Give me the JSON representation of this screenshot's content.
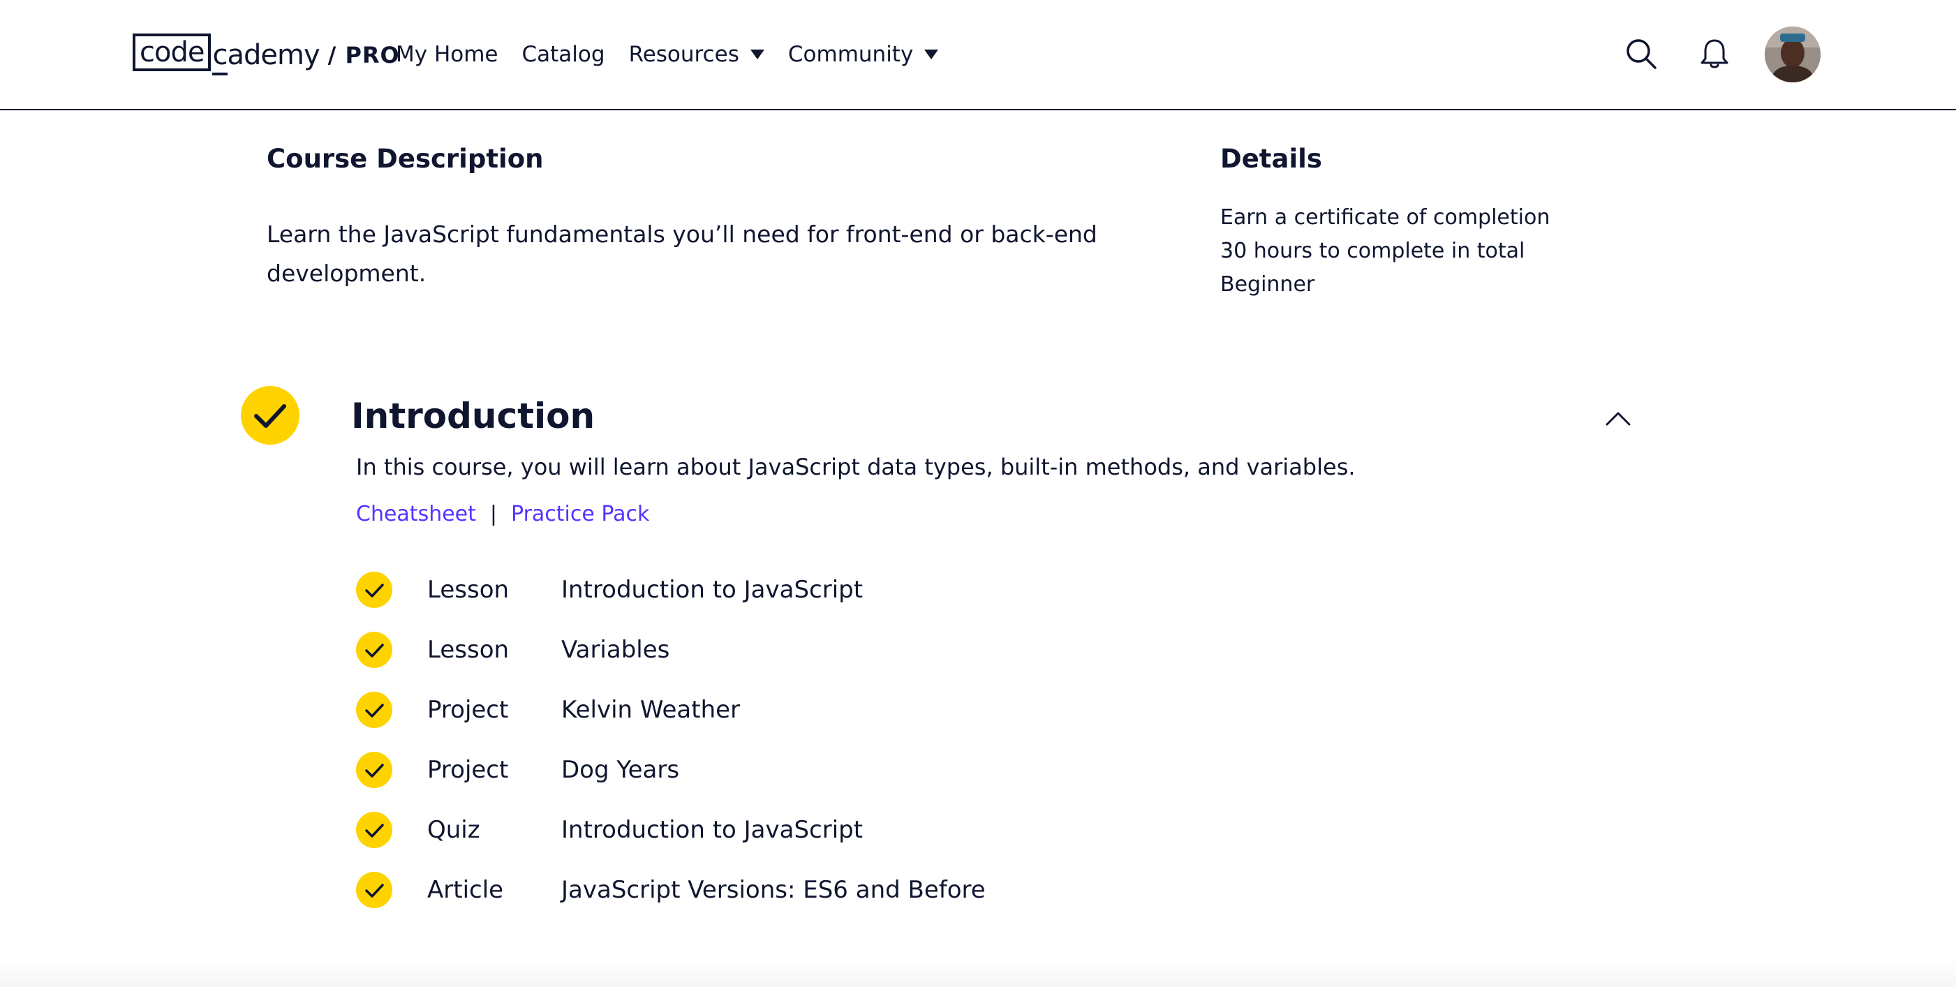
{
  "header": {
    "logo": {
      "code_text": "code",
      "cademy_text": "cademy",
      "pro_text": "/ PRO"
    },
    "nav": [
      {
        "label": "My Home"
      },
      {
        "label": "Catalog"
      },
      {
        "label": "Resources"
      },
      {
        "label": "Community"
      }
    ],
    "icons": {
      "search": "search-icon",
      "notifications": "bell-icon"
    }
  },
  "course": {
    "description_heading": "Course Description",
    "description": "Learn the JavaScript fundamentals you’ll need for front-end or back-end development.",
    "details_heading": "Details",
    "details": [
      "Earn a certificate of completion",
      "30 hours to complete in total",
      "Beginner"
    ]
  },
  "module": {
    "title": "Introduction",
    "description": "In this course, you will learn about JavaScript data types, built-in methods, and variables.",
    "links": {
      "cheatsheet": "Cheatsheet",
      "separator": "|",
      "practice_pack": "Practice Pack"
    },
    "items": [
      {
        "type": "Lesson",
        "title": "Introduction to JavaScript"
      },
      {
        "type": "Lesson",
        "title": "Variables"
      },
      {
        "type": "Project",
        "title": "Kelvin Weather"
      },
      {
        "type": "Project",
        "title": "Dog Years"
      },
      {
        "type": "Quiz",
        "title": "Introduction to JavaScript"
      },
      {
        "type": "Article",
        "title": "JavaScript Versions: ES6 and Before"
      }
    ]
  },
  "colors": {
    "navy": "#10162f",
    "check_yellow": "#ffd300",
    "link_purple": "#5533ff"
  }
}
